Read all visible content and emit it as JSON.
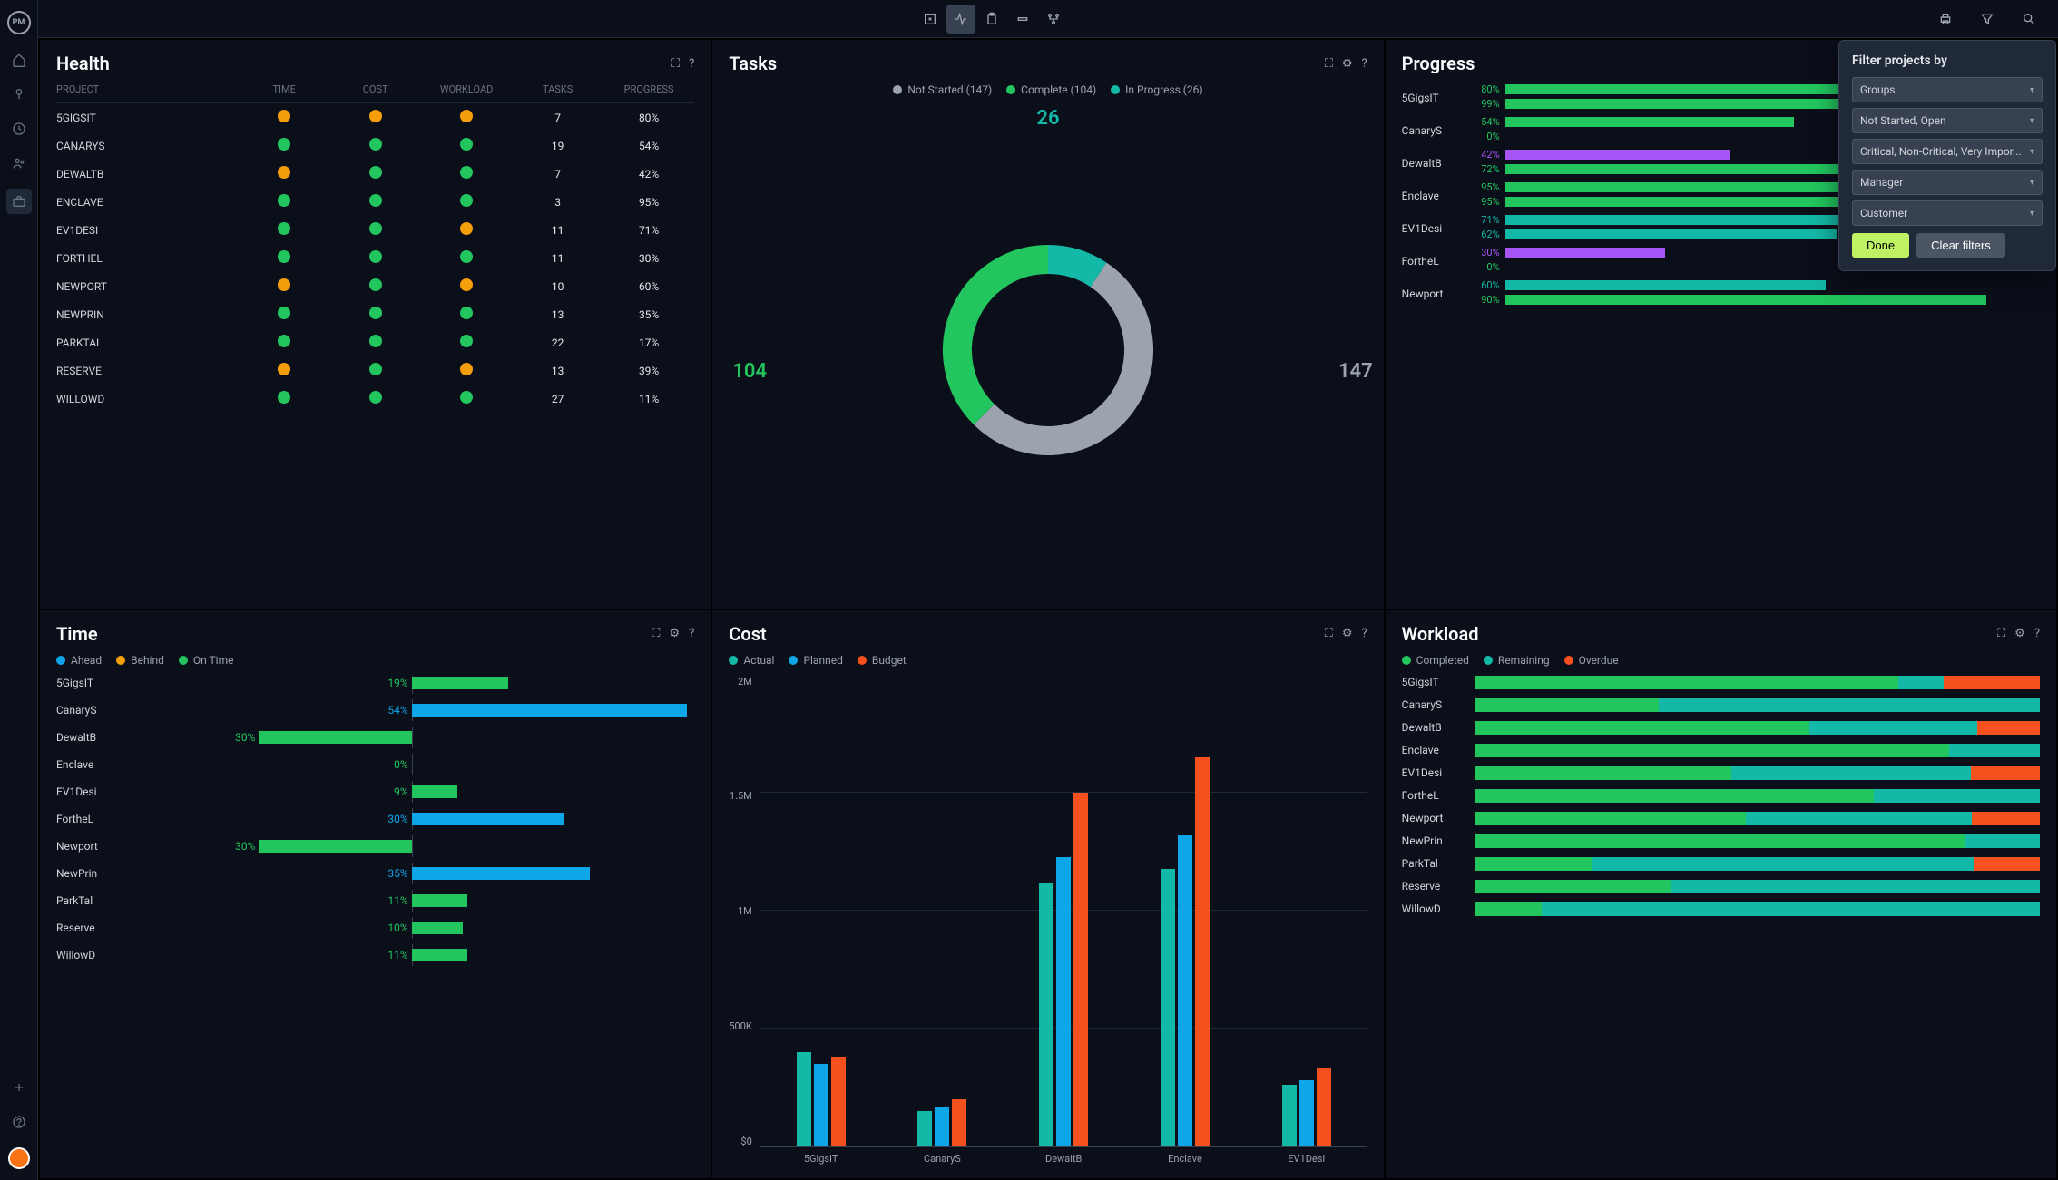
{
  "sidebar": {
    "logo_text": "PM"
  },
  "filter": {
    "title": "Filter projects by",
    "selects": [
      "Groups",
      "Not Started, Open",
      "Critical, Non-Critical, Very Impor...",
      "Manager",
      "Customer"
    ],
    "done": "Done",
    "clear": "Clear filters"
  },
  "health": {
    "title": "Health",
    "columns": [
      "PROJECT",
      "TIME",
      "COST",
      "WORKLOAD",
      "TASKS",
      "PROGRESS"
    ],
    "rows": [
      {
        "name": "5GIGSIT",
        "time": "orange",
        "cost": "orange",
        "workload": "orange",
        "tasks": 7,
        "progress": "80%"
      },
      {
        "name": "CANARYS",
        "time": "green",
        "cost": "green",
        "workload": "green",
        "tasks": 19,
        "progress": "54%"
      },
      {
        "name": "DEWALTB",
        "time": "orange",
        "cost": "green",
        "workload": "green",
        "tasks": 7,
        "progress": "42%"
      },
      {
        "name": "ENCLAVE",
        "time": "green",
        "cost": "green",
        "workload": "green",
        "tasks": 3,
        "progress": "95%"
      },
      {
        "name": "EV1DESI",
        "time": "green",
        "cost": "green",
        "workload": "orange",
        "tasks": 11,
        "progress": "71%"
      },
      {
        "name": "FORTHEL",
        "time": "green",
        "cost": "green",
        "workload": "green",
        "tasks": 11,
        "progress": "30%"
      },
      {
        "name": "NEWPORT",
        "time": "orange",
        "cost": "green",
        "workload": "orange",
        "tasks": 10,
        "progress": "60%"
      },
      {
        "name": "NEWPRIN",
        "time": "green",
        "cost": "green",
        "workload": "green",
        "tasks": 13,
        "progress": "35%"
      },
      {
        "name": "PARKTAL",
        "time": "green",
        "cost": "green",
        "workload": "green",
        "tasks": 22,
        "progress": "17%"
      },
      {
        "name": "RESERVE",
        "time": "orange",
        "cost": "green",
        "workload": "orange",
        "tasks": 13,
        "progress": "39%"
      },
      {
        "name": "WILLOWD",
        "time": "green",
        "cost": "green",
        "workload": "green",
        "tasks": 27,
        "progress": "11%"
      }
    ]
  },
  "tasks": {
    "title": "Tasks",
    "legend": [
      {
        "label": "Not Started (147)",
        "color": "gray"
      },
      {
        "label": "Complete (104)",
        "color": "green"
      },
      {
        "label": "In Progress (26)",
        "color": "teal"
      }
    ],
    "values": {
      "not_started": 147,
      "complete": 104,
      "in_progress": 26
    }
  },
  "progress": {
    "title": "Progress",
    "rows": [
      {
        "name": "5GigsIT",
        "bars": [
          {
            "pct": 80,
            "color": "green"
          },
          {
            "pct": 99,
            "color": "green"
          }
        ]
      },
      {
        "name": "CanaryS",
        "bars": [
          {
            "pct": 54,
            "color": "green"
          },
          {
            "pct": 0,
            "color": "green"
          }
        ]
      },
      {
        "name": "DewaltB",
        "bars": [
          {
            "pct": 42,
            "color": "purple"
          },
          {
            "pct": 72,
            "color": "green"
          }
        ]
      },
      {
        "name": "Enclave",
        "bars": [
          {
            "pct": 95,
            "color": "green"
          },
          {
            "pct": 95,
            "color": "green"
          }
        ]
      },
      {
        "name": "EV1Desi",
        "bars": [
          {
            "pct": 71,
            "color": "teal"
          },
          {
            "pct": 62,
            "color": "teal"
          }
        ]
      },
      {
        "name": "FortheL",
        "bars": [
          {
            "pct": 30,
            "color": "purple"
          },
          {
            "pct": 0,
            "color": "green"
          }
        ]
      },
      {
        "name": "Newport",
        "bars": [
          {
            "pct": 60,
            "color": "teal"
          },
          {
            "pct": 90,
            "color": "green"
          }
        ]
      }
    ]
  },
  "time": {
    "title": "Time",
    "legend": [
      {
        "label": "Ahead",
        "color": "blue"
      },
      {
        "label": "Behind",
        "color": "orange"
      },
      {
        "label": "On Time",
        "color": "green"
      }
    ],
    "rows": [
      {
        "name": "5GigsIT",
        "pct": 19,
        "color": "green",
        "dir": "right"
      },
      {
        "name": "CanaryS",
        "pct": 54,
        "color": "blue",
        "dir": "right"
      },
      {
        "name": "DewaltB",
        "pct": 30,
        "color": "green",
        "dir": "left"
      },
      {
        "name": "Enclave",
        "pct": 0,
        "color": "green",
        "dir": "right"
      },
      {
        "name": "EV1Desi",
        "pct": 9,
        "color": "green",
        "dir": "right"
      },
      {
        "name": "FortheL",
        "pct": 30,
        "color": "blue",
        "dir": "right"
      },
      {
        "name": "Newport",
        "pct": 30,
        "color": "green",
        "dir": "left"
      },
      {
        "name": "NewPrin",
        "pct": 35,
        "color": "blue",
        "dir": "right"
      },
      {
        "name": "ParkTal",
        "pct": 11,
        "color": "green",
        "dir": "right"
      },
      {
        "name": "Reserve",
        "pct": 10,
        "color": "green",
        "dir": "right"
      },
      {
        "name": "WillowD",
        "pct": 11,
        "color": "green",
        "dir": "right"
      }
    ]
  },
  "cost": {
    "title": "Cost",
    "legend": [
      {
        "label": "Actual",
        "color": "teal"
      },
      {
        "label": "Planned",
        "color": "blue"
      },
      {
        "label": "Budget",
        "color": "red"
      }
    ],
    "ymax": 2000000,
    "yticks": [
      "2M",
      "1.5M",
      "1M",
      "500K",
      "$0"
    ],
    "groups": [
      {
        "name": "5GigsIT",
        "actual": 400000,
        "planned": 350000,
        "budget": 380000
      },
      {
        "name": "CanaryS",
        "actual": 150000,
        "planned": 170000,
        "budget": 200000
      },
      {
        "name": "DewaltB",
        "actual": 1120000,
        "planned": 1230000,
        "budget": 1500000
      },
      {
        "name": "Enclave",
        "actual": 1180000,
        "planned": 1320000,
        "budget": 1650000
      },
      {
        "name": "EV1Desi",
        "actual": 260000,
        "planned": 280000,
        "budget": 330000
      }
    ]
  },
  "workload": {
    "title": "Workload",
    "legend": [
      {
        "label": "Completed",
        "color": "green"
      },
      {
        "label": "Remaining",
        "color": "teal"
      },
      {
        "label": "Overdue",
        "color": "red"
      }
    ],
    "rows": [
      {
        "name": "5GigsIT",
        "completed": 75,
        "remaining": 8,
        "overdue": 17,
        "total": 100
      },
      {
        "name": "CanaryS",
        "completed": 30,
        "remaining": 62,
        "overdue": 0,
        "total": 92
      },
      {
        "name": "DewaltB",
        "completed": 32,
        "remaining": 16,
        "overdue": 6,
        "total": 54
      },
      {
        "name": "Enclave",
        "completed": 42,
        "remaining": 8,
        "overdue": 0,
        "total": 50
      },
      {
        "name": "EV1Desi",
        "completed": 30,
        "remaining": 28,
        "overdue": 8,
        "total": 66
      },
      {
        "name": "FortheL",
        "completed": 24,
        "remaining": 10,
        "overdue": 0,
        "total": 34
      },
      {
        "name": "Newport",
        "completed": 24,
        "remaining": 20,
        "overdue": 6,
        "total": 50
      },
      {
        "name": "NewPrin",
        "completed": 26,
        "remaining": 4,
        "overdue": 0,
        "total": 30
      },
      {
        "name": "ParkTal",
        "completed": 18,
        "remaining": 58,
        "overdue": 10,
        "total": 86
      },
      {
        "name": "Reserve",
        "completed": 16,
        "remaining": 30,
        "overdue": 0,
        "total": 46
      },
      {
        "name": "WillowD",
        "completed": 12,
        "remaining": 88,
        "overdue": 0,
        "total": 100
      }
    ]
  },
  "chart_data": [
    {
      "type": "pie",
      "title": "Tasks",
      "series": [
        {
          "name": "Not Started",
          "value": 147
        },
        {
          "name": "Complete",
          "value": 104
        },
        {
          "name": "In Progress",
          "value": 26
        }
      ]
    },
    {
      "type": "bar",
      "title": "Cost",
      "categories": [
        "5GigsIT",
        "CanaryS",
        "DewaltB",
        "Enclave",
        "EV1Desi"
      ],
      "series": [
        {
          "name": "Actual",
          "values": [
            400000,
            150000,
            1120000,
            1180000,
            260000
          ]
        },
        {
          "name": "Planned",
          "values": [
            350000,
            170000,
            1230000,
            1320000,
            280000
          ]
        },
        {
          "name": "Budget",
          "values": [
            380000,
            200000,
            1500000,
            1650000,
            330000
          ]
        }
      ],
      "ylabel": "",
      "ylim": [
        0,
        2000000
      ]
    }
  ]
}
